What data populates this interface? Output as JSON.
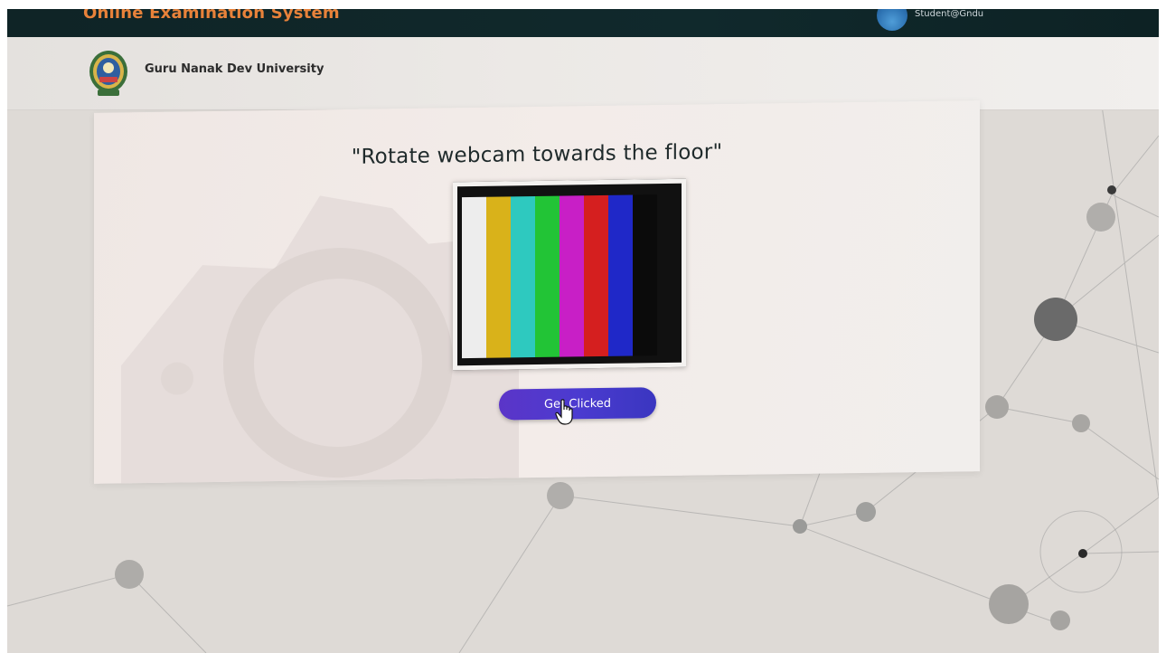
{
  "app": {
    "title": "Online Examination System",
    "user_email": "Student@Gndu"
  },
  "header": {
    "university_name": "Guru Nanak Dev University"
  },
  "main": {
    "instruction": "\"Rotate webcam towards the floor\"",
    "button_label": "Get Clicked",
    "test_pattern_colors": [
      "#ededed",
      "#d9b21a",
      "#2ec9bf",
      "#22c436",
      "#c81fc6",
      "#d51f1f",
      "#1f28c8",
      "#0b0b0b"
    ]
  },
  "colors": {
    "topbar": "#10292c",
    "title_orange": "#e8823a",
    "button_purple": "#4b3bd0"
  }
}
